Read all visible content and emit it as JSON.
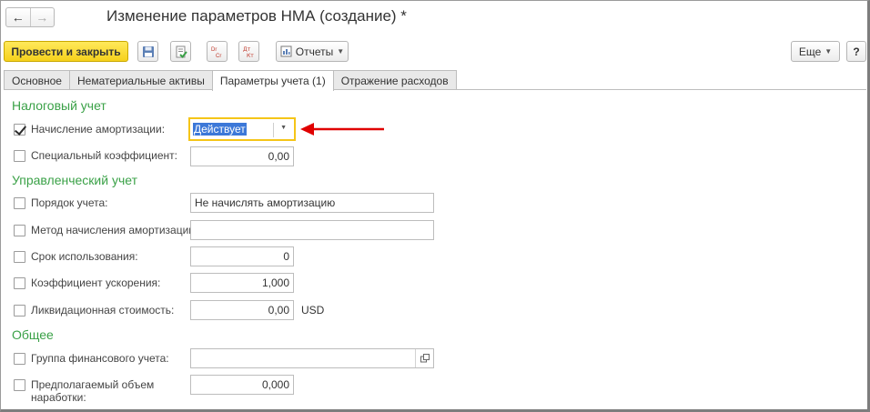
{
  "window": {
    "title": "Изменение параметров НМА (создание) *"
  },
  "toolbar": {
    "post_close_label": "Провести и закрыть",
    "reports_label": "Отчеты",
    "more_label": "Еще",
    "help_label": "?",
    "dt_kt_label": "Дт Кт",
    "dr_cr_label": "Dr Cr"
  },
  "tabs": [
    {
      "label": "Основное"
    },
    {
      "label": "Нематериальные активы"
    },
    {
      "label": "Параметры учета (1)"
    },
    {
      "label": "Отражение расходов"
    }
  ],
  "tax": {
    "heading": "Налоговый учет",
    "depreciation_label": "Начисление амортизации:",
    "depreciation_value": "Действует",
    "depreciation_checked": true,
    "special_coef_label": "Специальный коэффициент:",
    "special_coef_value": "0,00"
  },
  "management": {
    "heading": "Управленческий учет",
    "accounting_order_label": "Порядок учета:",
    "accounting_order_value": "Не начислять амортизацию",
    "method_label": "Метод начисления амортизации:",
    "method_value": "",
    "useful_life_label": "Срок использования:",
    "useful_life_value": "0",
    "accel_coef_label": "Коэффициент ускорения:",
    "accel_coef_value": "1,000",
    "liquidation_label": "Ликвидационная стоимость:",
    "liquidation_value": "0,00",
    "liquidation_currency": "USD"
  },
  "general": {
    "heading": "Общее",
    "fin_group_label": "Группа финансового учета:",
    "fin_group_value": "",
    "volume_label_line1": "Предполагаемый объем",
    "volume_label_line2": "наработки:",
    "volume_value": "0,000"
  },
  "annotation": {
    "arrow_color": "#e00000"
  },
  "colors": {
    "accent_green": "#3aa147",
    "primary_button": "#f6d11c",
    "focus_border": "#f5c518",
    "selection": "#3c78d8"
  }
}
